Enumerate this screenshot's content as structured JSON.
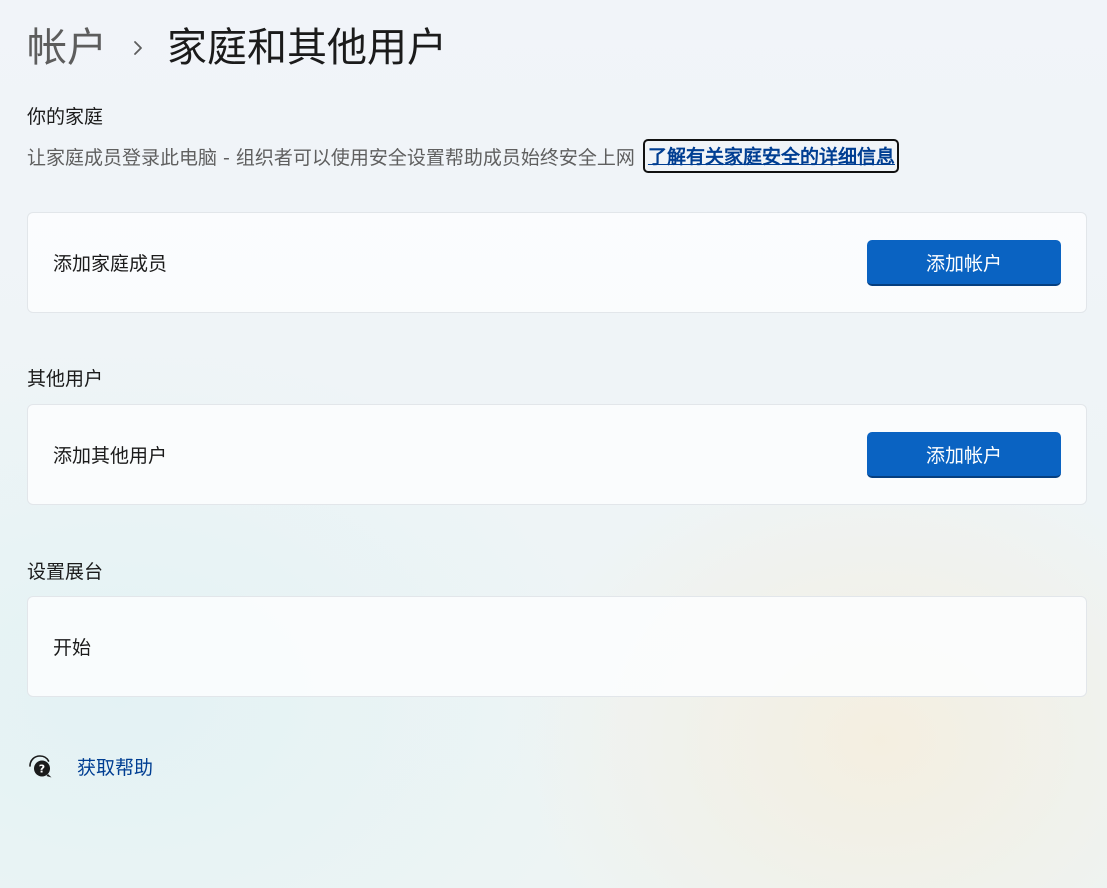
{
  "breadcrumb": {
    "parent": "帐户",
    "separator_icon": "chevron-right-icon",
    "current": "家庭和其他用户"
  },
  "family": {
    "title": "你的家庭",
    "description": "让家庭成员登录此电脑 - 组织者可以使用安全设置帮助成员始终安全上网",
    "learn_more_link": "了解有关家庭安全的详细信息",
    "card_label": "添加家庭成员",
    "button_label": "添加帐户"
  },
  "other_users": {
    "title": "其他用户",
    "card_label": "添加其他用户",
    "button_label": "添加帐户"
  },
  "kiosk": {
    "title": "设置展台",
    "card_label": "开始"
  },
  "help": {
    "icon": "help-chat-icon",
    "label": "获取帮助"
  },
  "colors": {
    "accent": "#0a63c2",
    "link": "#003e92"
  }
}
